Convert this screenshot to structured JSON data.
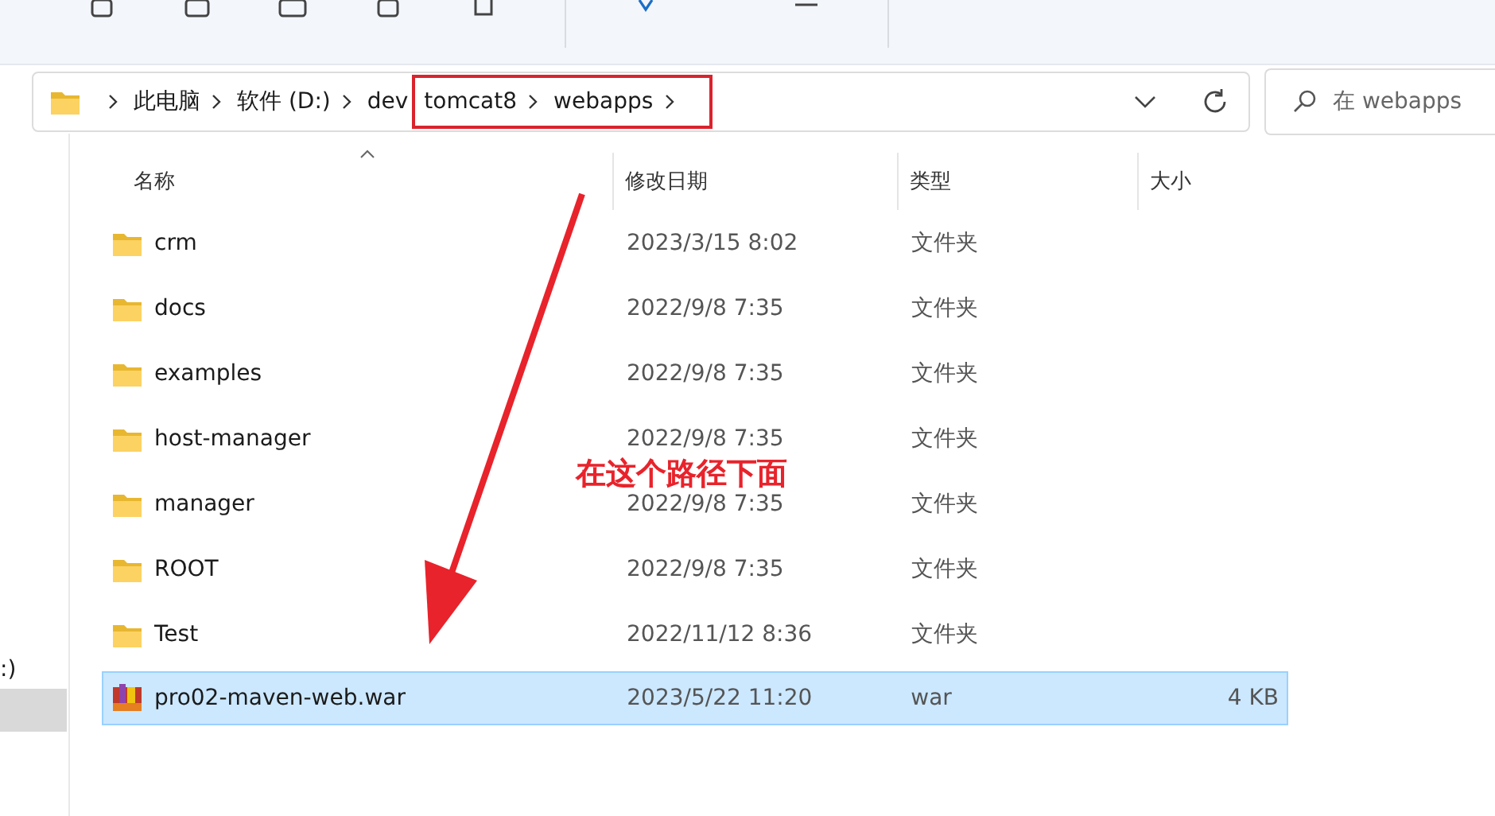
{
  "address_bar": {
    "crumbs": [
      {
        "label": "此电脑",
        "highlighted": false
      },
      {
        "label": "软件 (D:)",
        "highlighted": false
      },
      {
        "label": "dev",
        "highlighted": false
      },
      {
        "label": "tomcat8",
        "highlighted": true
      },
      {
        "label": "webapps",
        "highlighted": true
      }
    ]
  },
  "search": {
    "placeholder": "在 webapps"
  },
  "nav_pane": {
    "items": [
      {
        "label": ":)",
        "selected": false
      },
      {
        "selected": true
      }
    ]
  },
  "table": {
    "columns": [
      {
        "label": "名称",
        "sorted": true
      },
      {
        "label": "修改日期",
        "sorted": false
      },
      {
        "label": "类型",
        "sorted": false
      },
      {
        "label": "大小",
        "sorted": false
      }
    ],
    "rows": [
      {
        "kind": "folder",
        "name": "crm",
        "date": "2023/3/15 8:02",
        "type": "文件夹",
        "selected": false
      },
      {
        "kind": "folder",
        "name": "docs",
        "date": "2022/9/8 7:35",
        "type": "文件夹",
        "selected": false
      },
      {
        "kind": "folder",
        "name": "examples",
        "date": "2022/9/8 7:35",
        "type": "文件夹",
        "selected": false
      },
      {
        "kind": "folder",
        "name": "host-manager",
        "date": "2022/9/8 7:35",
        "type": "文件夹",
        "selected": false
      },
      {
        "kind": "folder",
        "name": "manager",
        "date": "2022/9/8 7:35",
        "type": "文件夹",
        "selected": false
      },
      {
        "kind": "folder",
        "name": "ROOT",
        "date": "2022/9/8 7:35",
        "type": "文件夹",
        "selected": false
      },
      {
        "kind": "folder",
        "name": "Test",
        "date": "2022/11/12 8:36",
        "type": "文件夹",
        "selected": false
      },
      {
        "kind": "archive",
        "name": "pro02-maven-web.war",
        "date": "2023/5/22 11:20",
        "type": "war",
        "size": "4 KB",
        "selected": true
      }
    ]
  },
  "annotation": {
    "text": "在这个路径下面"
  }
}
